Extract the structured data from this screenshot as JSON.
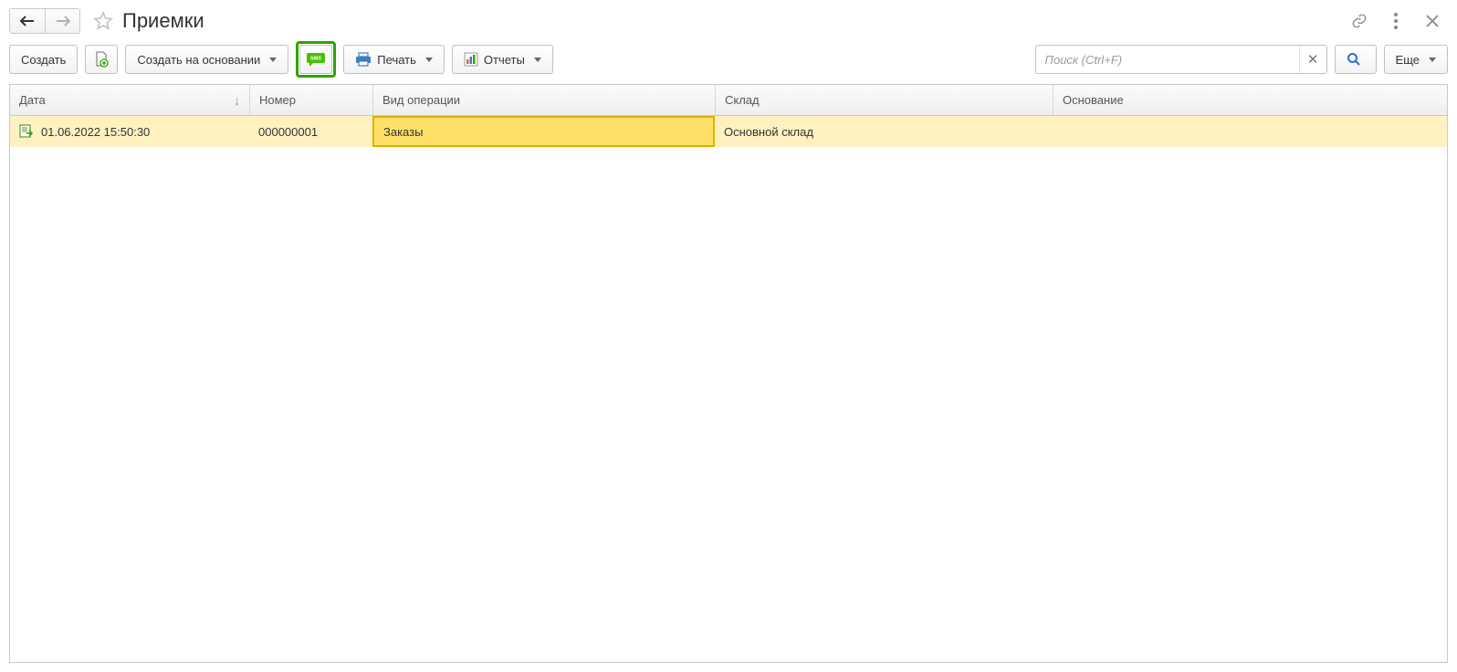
{
  "header": {
    "title": "Приемки"
  },
  "toolbar": {
    "create_label": "Создать",
    "create_based_label": "Создать на основании",
    "print_label": "Печать",
    "reports_label": "Отчеты",
    "more_label": "Еще",
    "search_placeholder": "Поиск (Ctrl+F)"
  },
  "grid": {
    "columns": {
      "date": "Дата",
      "number": "Номер",
      "operation": "Вид операции",
      "warehouse": "Склад",
      "basis": "Основание"
    },
    "rows": [
      {
        "date": "01.06.2022 15:50:30",
        "number": "000000001",
        "operation": "Заказы",
        "warehouse": "Основной склад",
        "basis": ""
      }
    ]
  }
}
